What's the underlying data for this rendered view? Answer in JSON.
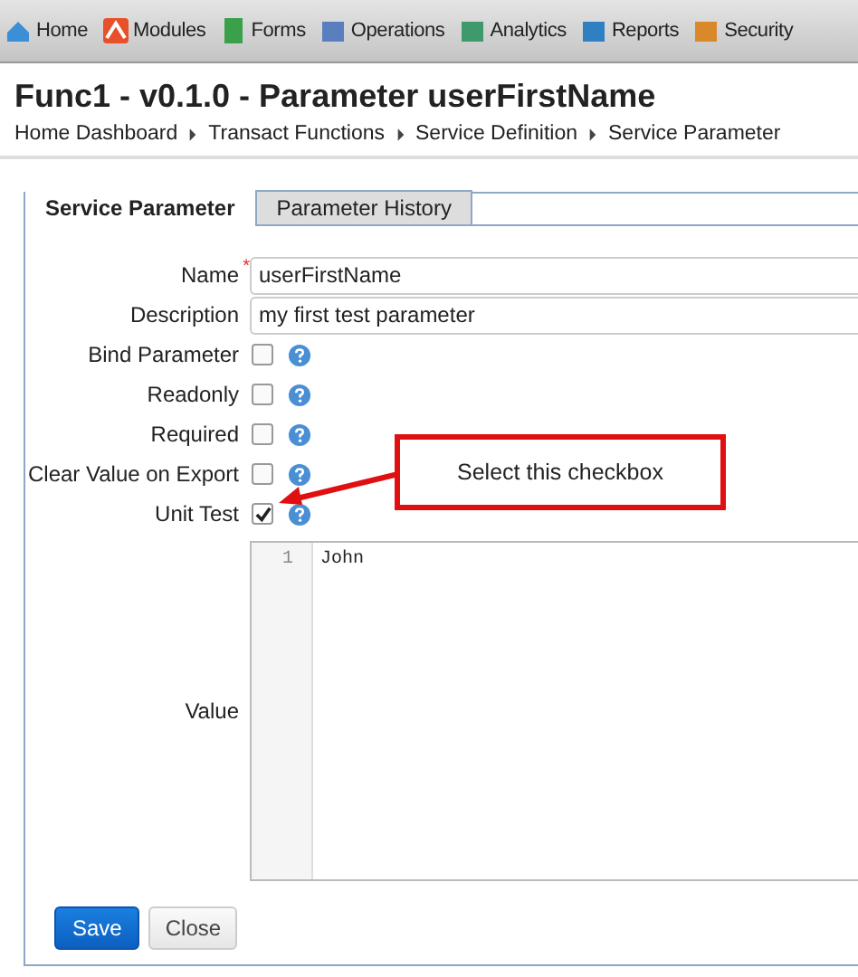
{
  "nav": [
    {
      "label": "Home"
    },
    {
      "label": "Modules"
    },
    {
      "label": "Forms"
    },
    {
      "label": "Operations"
    },
    {
      "label": "Analytics"
    },
    {
      "label": "Reports"
    },
    {
      "label": "Security"
    }
  ],
  "title": "Func1 - v0.1.0 - Parameter userFirstName",
  "breadcrumb": [
    "Home Dashboard",
    "Transact Functions",
    "Service Definition",
    "Service Parameter"
  ],
  "tabs": [
    {
      "label": "Service Parameter",
      "selected": true
    },
    {
      "label": "Parameter History",
      "selected": false
    }
  ],
  "fields": [
    {
      "kind": "text",
      "label": "Name",
      "marker": "*",
      "value": "userFirstName"
    },
    {
      "kind": "text",
      "label": "Description",
      "value": "my first test parameter"
    },
    {
      "kind": "checkbox",
      "label": "Bind Parameter",
      "checked": false
    },
    {
      "kind": "checkbox",
      "label": "Readonly",
      "checked": false
    },
    {
      "kind": "checkbox",
      "label": "Required",
      "checked": false
    },
    {
      "kind": "checkbox",
      "label": "Clear Value on Export",
      "checked": false
    },
    {
      "kind": "checkbox",
      "label": "Unit Test",
      "checked": true
    }
  ],
  "value_editor": {
    "label": "Value",
    "lines": [
      {
        "number": "1",
        "text": "John"
      }
    ]
  },
  "callout": "Select this checkbox",
  "buttons": [
    {
      "label": "Save",
      "kind": "primary"
    },
    {
      "label": "Close",
      "kind": "secondary"
    }
  ]
}
